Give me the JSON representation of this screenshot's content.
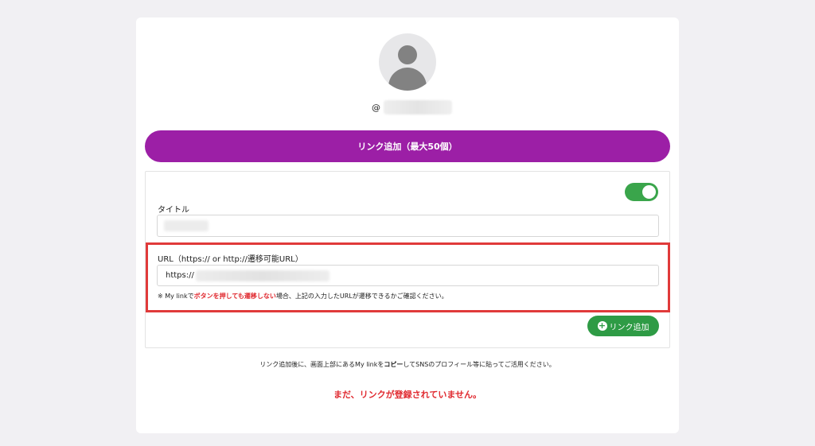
{
  "profile": {
    "at_symbol": "@"
  },
  "actions": {
    "add_link_max_label": "リンク追加（最大50個）",
    "add_link_label": "リンク追加"
  },
  "form": {
    "title_label": "タイトル",
    "url_label": "URL（https:// or http://遷移可能URL）",
    "url_value_prefix": "https://",
    "note_pre": "※ My linkで",
    "note_red": "ボタンを押しても遷移しない",
    "note_post": "場合、上記の入力したURLが遷移できるかご確認ください。",
    "toggle_state": "on"
  },
  "help": {
    "pre": "リンク追加後に、画面上部にあるMy linkを",
    "bold": "コピー",
    "post": "してSNSのプロフィール等に貼ってご活用ください。"
  },
  "empty_message": "まだ、リンクが登録されていません。",
  "colors": {
    "accent_purple": "#9c1fa6",
    "toggle_green": "#3aa54b",
    "button_green": "#2e9b45",
    "warning_red": "#e0282e",
    "highlight_border": "#e03a3a"
  },
  "icons": {
    "avatar": "user-avatar-icon",
    "add": "plus-circle-icon"
  }
}
